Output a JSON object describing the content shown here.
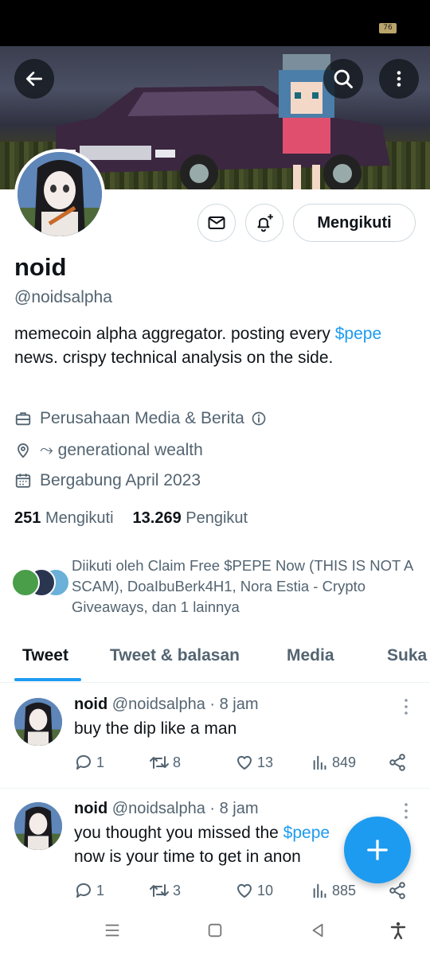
{
  "status_bar": {
    "battery": "76"
  },
  "profile": {
    "name": "noid",
    "handle": "@noidsalpha",
    "bio_prefix": "memecoin alpha aggregator. posting every ",
    "bio_link": "$pepe",
    "bio_suffix": " news. crispy technical analysis on the side.",
    "category": "Perusahaan Media & Berita",
    "location": "⤳ generational wealth",
    "joined": "Bergabung April 2023",
    "following_count": "251",
    "following_label": "Mengikuti",
    "followers_count": "13.269",
    "followers_label": "Pengikut",
    "follow_button": "Mengikuti",
    "followed_by": "Diikuti oleh Claim Free $PEPE Now (THIS IS NOT A SCAM), DoaIbuBerk4H1, Nora Estia - Crypto Giveaways, dan 1 lainnya"
  },
  "tabs": [
    {
      "label": "Tweet"
    },
    {
      "label": "Tweet & balasan"
    },
    {
      "label": "Media"
    },
    {
      "label": "Suka"
    }
  ],
  "tweets": [
    {
      "name": "noid",
      "meta": "@noidsalpha · 8 jam",
      "text": "buy the dip like a man",
      "replies": "1",
      "retweets": "8",
      "likes": "13",
      "views": "849"
    },
    {
      "name": "noid",
      "meta": "@noidsalpha · 8 jam",
      "text_prefix": "you thought you missed the ",
      "text_link": "$pepe",
      "text_suffix": "now is your time to get in anon",
      "replies": "1",
      "retweets": "3",
      "likes": "10",
      "views": "885"
    }
  ],
  "colors": {
    "accent": "#1d9bf0",
    "text_primary": "#0f1419",
    "text_secondary": "#536471"
  }
}
